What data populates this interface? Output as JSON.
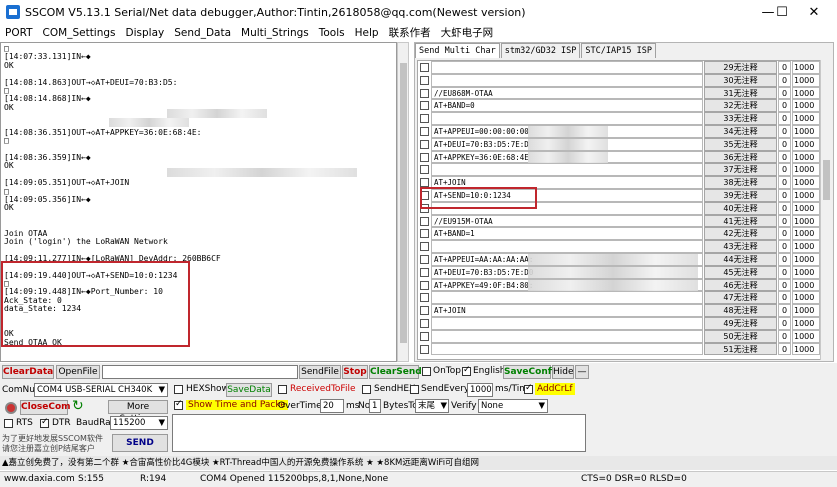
{
  "window": {
    "title": "SSCOM V5.13.1 Serial/Net data debugger,Author:Tintin,2618058@qq.com(Newest version)"
  },
  "menu": [
    "PORT",
    "COM_Settings",
    "Display",
    "Send_Data",
    "Multi_Strings",
    "Tools",
    "Help",
    "联系作者",
    "大虾电子网"
  ],
  "log": [
    "□",
    "[14:07:33.131]IN←◆",
    "OK",
    "",
    "[14:08:14.863]OUT→◇AT+DEUI=70:B3:D5:",
    "□",
    "[14:08:14.868]IN←◆",
    "OK",
    "",
    "",
    "[14:08:36.351]OUT→◇AT+APPKEY=36:0E:68:4E:",
    "□",
    "",
    "[14:08:36.359]IN←◆",
    "OK",
    "",
    "[14:09:05.351]OUT→◇AT+JOIN",
    "□",
    "[14:09:05.356]IN←◆",
    "OK",
    "",
    "",
    "Join OTAA",
    "Join ('login') the LoRaWAN Network",
    "",
    "[14:09:11.277]IN←◆[LoRaWAN] DevAddr: 260BB6CF",
    "",
    "[14:09:19.440]OUT→◇AT+SEND=10:0:1234",
    "□",
    "[14:09:19.448]IN←◆Port_Number: 10",
    "Ack_State: 0",
    "data_State: 1234",
    "",
    "",
    "OK",
    "Send OTAA OK"
  ],
  "tabs": [
    "Send Multi Char",
    "stm32/GD32 ISP",
    "STC/IAP15 ISP"
  ],
  "rows": [
    {
      "cmd": "",
      "btn": "29无注释",
      "n": "0",
      "delay": "1000"
    },
    {
      "cmd": "",
      "btn": "30无注释",
      "n": "0",
      "delay": "1000"
    },
    {
      "cmd": "//EU868M-OTAA",
      "btn": "31无注释",
      "n": "0",
      "delay": "1000"
    },
    {
      "cmd": "AT+BAND=0",
      "btn": "32无注释",
      "n": "0",
      "delay": "1000"
    },
    {
      "cmd": "",
      "btn": "33无注释",
      "n": "0",
      "delay": "1000"
    },
    {
      "cmd": "AT+APPEUI=00:00:00:00",
      "btn": "34无注释",
      "n": "0",
      "delay": "1000"
    },
    {
      "cmd": "AT+DEUI=70:B3:D5:7E:D",
      "btn": "35无注释",
      "n": "0",
      "delay": "1000"
    },
    {
      "cmd": "AT+APPKEY=36:0E:68:4E",
      "btn": "36无注释",
      "n": "0",
      "delay": "1000"
    },
    {
      "cmd": "",
      "btn": "37无注释",
      "n": "0",
      "delay": "1000"
    },
    {
      "cmd": "AT+JOIN",
      "btn": "38无注释",
      "n": "0",
      "delay": "1000"
    },
    {
      "cmd": "AT+SEND=10:0:1234",
      "btn": "39无注释",
      "n": "0",
      "delay": "1000"
    },
    {
      "cmd": "",
      "btn": "40无注释",
      "n": "0",
      "delay": "1000"
    },
    {
      "cmd": "//EU915M-OTAA",
      "btn": "41无注释",
      "n": "0",
      "delay": "1000"
    },
    {
      "cmd": "AT+BAND=1",
      "btn": "42无注释",
      "n": "0",
      "delay": "1000"
    },
    {
      "cmd": "",
      "btn": "43无注释",
      "n": "0",
      "delay": "1000"
    },
    {
      "cmd": "AT+APPEUI=AA:AA:AA:AA:",
      "btn": "44无注释",
      "n": "0",
      "delay": "1000"
    },
    {
      "cmd": "AT+DEUI=70:B3:D5:7E:D0",
      "btn": "45无注释",
      "n": "0",
      "delay": "1000"
    },
    {
      "cmd": "AT+APPKEY=49:0F:B4:80:",
      "btn": "46无注释",
      "n": "0",
      "delay": "1000"
    },
    {
      "cmd": "",
      "btn": "47无注释",
      "n": "0",
      "delay": "1000"
    },
    {
      "cmd": "AT+JOIN",
      "btn": "48无注释",
      "n": "0",
      "delay": "1000"
    },
    {
      "cmd": "",
      "btn": "49无注释",
      "n": "0",
      "delay": "1000"
    },
    {
      "cmd": "",
      "btn": "50无注释",
      "n": "0",
      "delay": "1000"
    },
    {
      "cmd": "",
      "btn": "51无注释",
      "n": "0",
      "delay": "1000"
    }
  ],
  "controls": {
    "clear_data": "ClearData",
    "open_file": "OpenFile",
    "send_file": "SendFile",
    "stop": "Stop",
    "clear_send": "ClearSend",
    "on_top": "OnTop",
    "english": "English",
    "save_config": "SaveConfig",
    "hide": "Hide",
    "minus": "—",
    "com_num_label": "ComNum",
    "com_num_value": "COM4 USB-SERIAL CH340K",
    "hex_show": "HEXShow",
    "save_data": "SaveData",
    "received_to_file": "ReceivedToFile",
    "send_hex": "SendHEX",
    "send_every": "SendEvery",
    "send_every_value": "1000",
    "ms_tim": "ms/Tim",
    "add_crlf": "AddCrLf",
    "close_com": "CloseCom",
    "more_settings": "More Settings",
    "show_time": "Show Time and Packe",
    "overtime": "OverTime:",
    "overtime_value": "20",
    "ms": "ms",
    "no": "No",
    "no_value": "1",
    "bytes_to": "BytesTo",
    "bytes_to_value": "末尾",
    "verify": "Verify",
    "verify_value": "None",
    "rts": "RTS",
    "dtr": "DTR",
    "baud_rate": "BaudRat:",
    "baud_value": "115200",
    "promo1": "为了更好地发展SSCOM软件",
    "promo2": "请您注册嘉立创P结尾客户",
    "send": "SEND"
  },
  "ad": "▲嘉立创免费了，没有第二个群 ★合宙高性价比4G模块 ★RT-Thread中国人的开源免费操作系统 ★ ★8KM远距离WiFi可自组网",
  "status": {
    "site": "www.daxia.com",
    "s": "S:155",
    "r": "R:194",
    "port": "COM4 Opened  115200bps,8,1,None,None",
    "lines": "CTS=0 DSR=0 RLSD=0"
  }
}
